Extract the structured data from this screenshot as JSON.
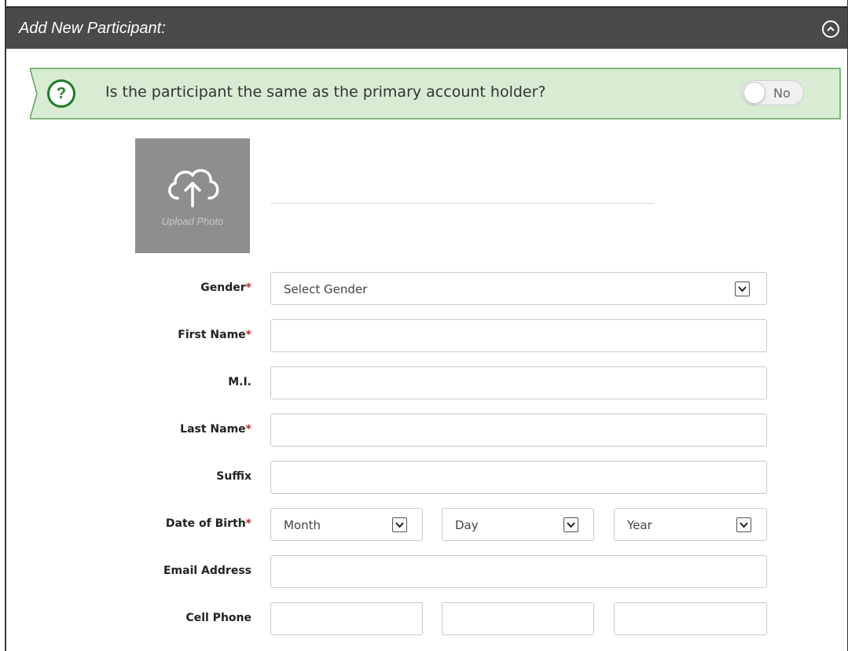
{
  "header": {
    "title": "Add New Participant:",
    "collapse_icon": "chevron-up-circle-icon"
  },
  "banner": {
    "question": "Is the participant the same as the primary account holder?",
    "help_icon": "?",
    "toggle_label": "No",
    "colors": {
      "background": "#d7ecd3",
      "border": "#5fa35a",
      "accent": "#1f7a2a"
    }
  },
  "upload": {
    "label": "Upload Photo",
    "icon": "cloud-upload-icon"
  },
  "form": {
    "gender": {
      "label": "Gender",
      "required": "*",
      "value": "Select Gender"
    },
    "first_name": {
      "label": "First Name",
      "required": "*",
      "value": ""
    },
    "middle_initial": {
      "label": "M.I.",
      "value": ""
    },
    "last_name": {
      "label": "Last Name",
      "required": "*",
      "value": ""
    },
    "suffix": {
      "label": "Suffix",
      "value": ""
    },
    "dob": {
      "label": "Date of Birth",
      "required": "*",
      "month": "Month",
      "day": "Day",
      "year": "Year"
    },
    "email": {
      "label": "Email Address",
      "value": ""
    },
    "cell_phone": {
      "label": "Cell Phone",
      "area": "",
      "prefix": "",
      "line": ""
    }
  }
}
